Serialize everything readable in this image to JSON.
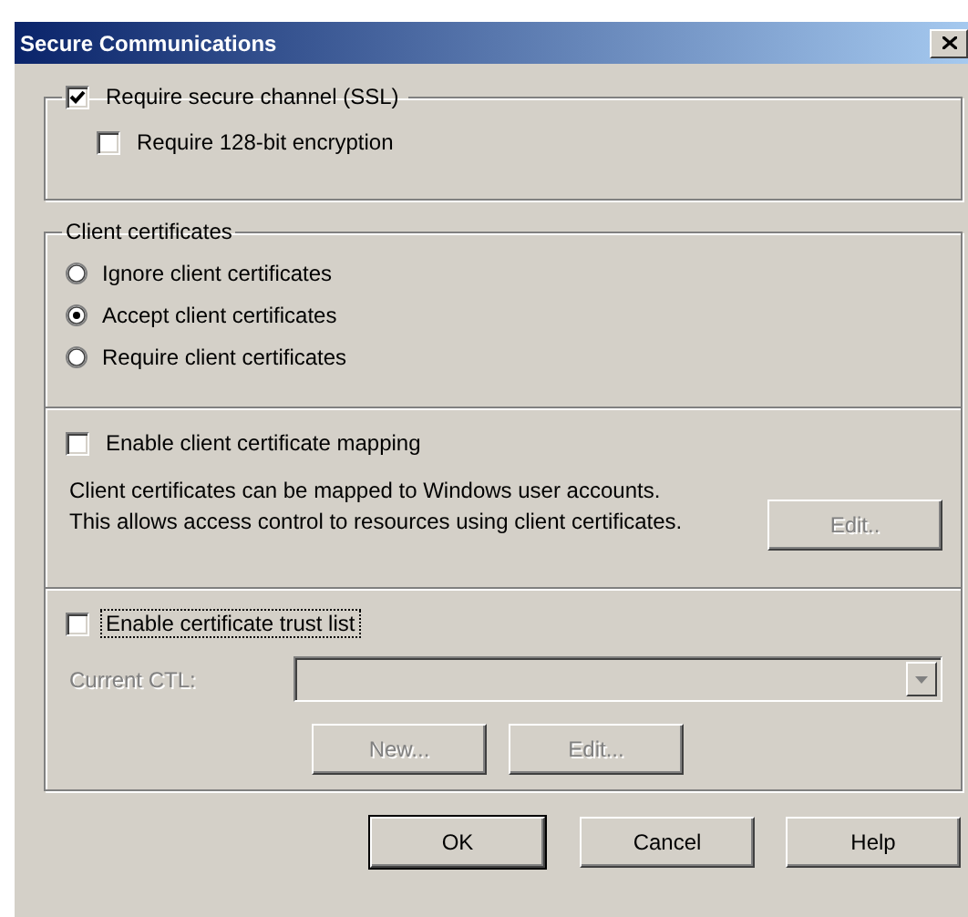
{
  "window": {
    "title": "Secure Communications"
  },
  "ssl_group": {
    "checkbox": {
      "label": "Require secure channel (SSL)",
      "checked": true,
      "focused": false
    },
    "options": [
      {
        "label": "Require 128-bit encryption",
        "checked": false,
        "focused": false
      }
    ]
  },
  "client_certificates": {
    "title": "Client certificates",
    "radios": [
      {
        "label": "Ignore client certificates",
        "selected": false
      },
      {
        "label": "Accept client certificates",
        "selected": true
      },
      {
        "label": "Require client certificates",
        "selected": false
      }
    ],
    "mapping": {
      "checkbox": {
        "label": "Enable client certificate mapping",
        "checked": false,
        "focused": false
      },
      "description": "Client certificates can be mapped to Windows user accounts.  This allows access control to resources using client certificates.",
      "edit_button": {
        "label": "Edit..",
        "disabled": true
      }
    },
    "trust_list": {
      "checkbox": {
        "label": "Enable certificate trust list",
        "checked": false,
        "focused": true
      },
      "current_ctl": {
        "label": "Current CTL:",
        "disabled": true
      },
      "buttons": [
        {
          "label": "New...",
          "disabled": true
        },
        {
          "label": "Edit...",
          "disabled": true
        }
      ]
    }
  },
  "buttons": [
    {
      "label": "OK",
      "default": true,
      "disabled": false
    },
    {
      "label": "Cancel",
      "default": false,
      "disabled": false
    },
    {
      "label": "Help",
      "default": false,
      "disabled": false
    }
  ]
}
